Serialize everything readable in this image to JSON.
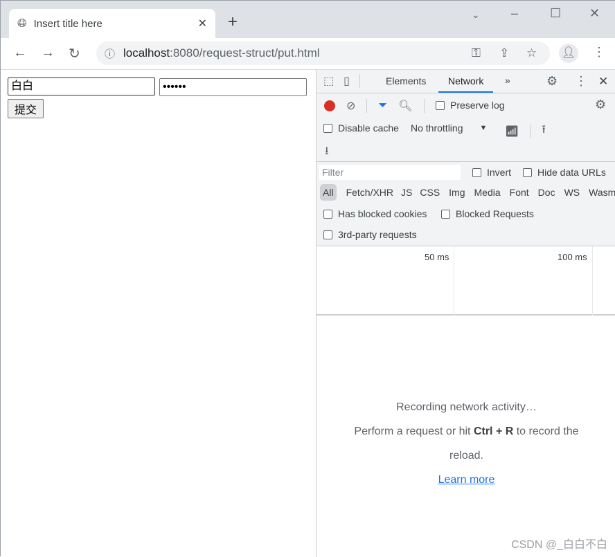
{
  "browser": {
    "tab_title": "Insert title here",
    "url_host": "localhost",
    "url_path": ":8080/request-struct/put.html"
  },
  "page": {
    "username_value": "白白",
    "password_value": "••••••",
    "submit_label": "提交"
  },
  "devtools": {
    "tabs": [
      "Elements",
      "Network"
    ],
    "active_tab": "Network",
    "preserve_log": "Preserve log",
    "disable_cache": "Disable cache",
    "throttling": "No throttling",
    "filter_placeholder": "Filter",
    "invert": "Invert",
    "hide_data_urls": "Hide data URLs",
    "types": [
      "All",
      "Fetch/XHR",
      "JS",
      "CSS",
      "Img",
      "Media",
      "Font",
      "Doc",
      "WS",
      "Wasm"
    ],
    "has_blocked_cookies": "Has blocked cookies",
    "blocked_requests": "Blocked Requests",
    "third_party": "3rd-party requests",
    "ticks": [
      "50 ms",
      "100 ms"
    ],
    "empty": {
      "line1": "Recording network activity…",
      "line2a": "Perform a request or hit ",
      "shortcut": "Ctrl + R",
      "line2b": " to record the",
      "line3": "reload.",
      "learn_more": "Learn more"
    },
    "record_color": "#d93025",
    "accent": "#1a73e8"
  },
  "watermark": "CSDN @_白白不白"
}
